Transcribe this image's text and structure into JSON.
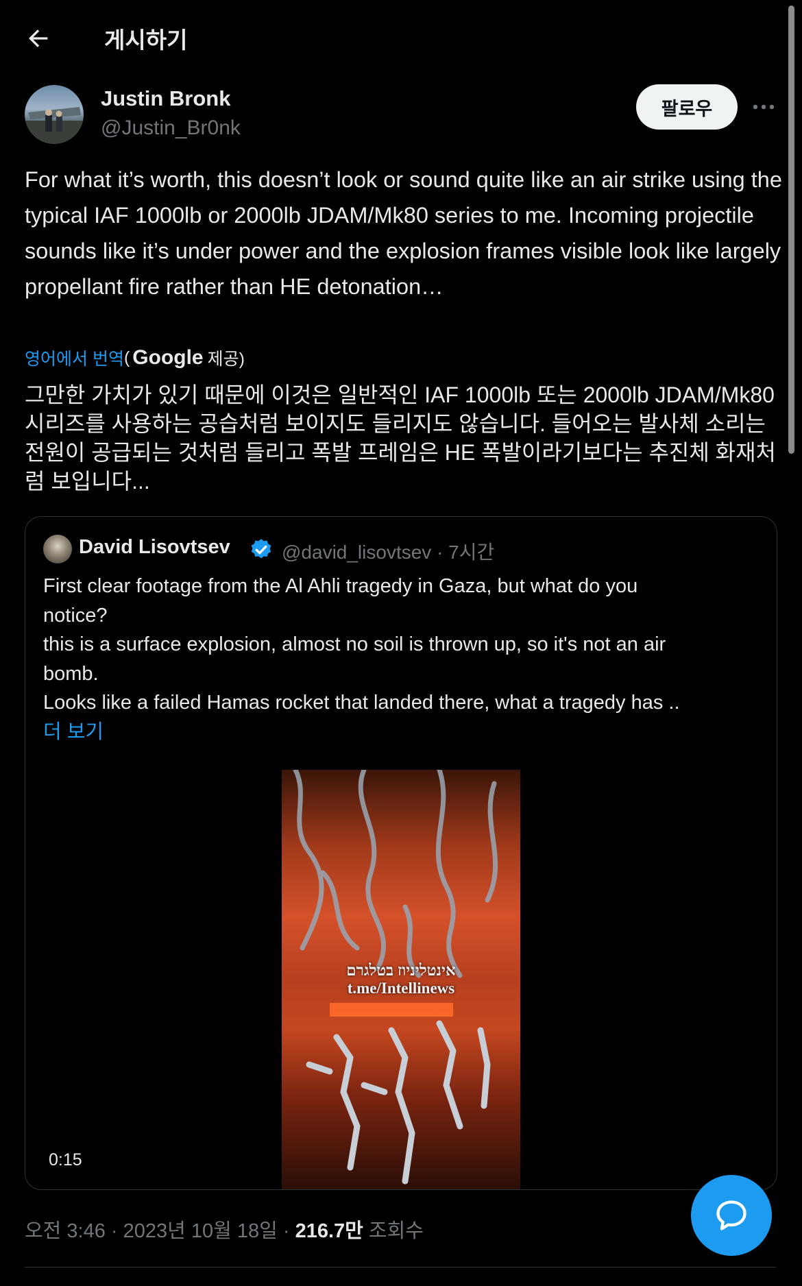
{
  "header": {
    "title": "게시하기",
    "back_icon": "arrow-left-icon"
  },
  "author": {
    "name": "Justin Bronk",
    "handle": "@Justin_Br0nk",
    "follow_label": "팔로우"
  },
  "tweet": {
    "text": "For what it’s worth, this doesn’t look or sound quite like an air strike using the typical IAF 1000lb or 2000lb JDAM/Mk80 series to me. Incoming projectile sounds like it’s under power and the explosion frames visible look like largely propellant fire rather than HE detonation…",
    "translate_link": "영어에서 번역",
    "translate_open": "(",
    "translate_provider": "Google",
    "translate_close": "제공)",
    "translated_text": "그만한 가치가 있기 때문에 이것은 일반적인 IAF 1000lb 또는 2000lb JDAM/Mk80 시리즈를 사용하는 공습처럼 보이지도 들리지도 않습니다. 들어오는 발사체 소리는 전원이 공급되는 것처럼 들리고 폭발 프레임은 HE 폭발이라기보다는 추진체 화재처럼 보입니다..."
  },
  "quote": {
    "name": "David Lisovtsev",
    "handle_time": "@david_lisovtsev · 7시간",
    "lines": [
      "First clear footage from the Al Ahli tragedy in Gaza, but what do you",
      "notice?",
      "this is a surface explosion, almost no soil is thrown up, so it's not an air",
      "bomb.",
      "Looks like a failed Hamas rocket that landed there, what a tragedy has .."
    ],
    "show_more": "더 보기",
    "watermark_line1": "אינטליניוז בטלגרם",
    "watermark_line2": "t.me/Intellinews",
    "duration": "0:15"
  },
  "meta": {
    "time_date": "오전 3:46 · 2023년 10월 18일 · ",
    "views": "216.7만",
    "views_label": " 조회수"
  },
  "colors": {
    "accent": "#1d9bf0",
    "background": "#000000",
    "secondary_text": "#71767b",
    "follow_bg": "#eff3f4"
  },
  "icons": [
    "arrow-left-icon",
    "more-icon",
    "verified-icon",
    "chat-bubble-icon"
  ]
}
